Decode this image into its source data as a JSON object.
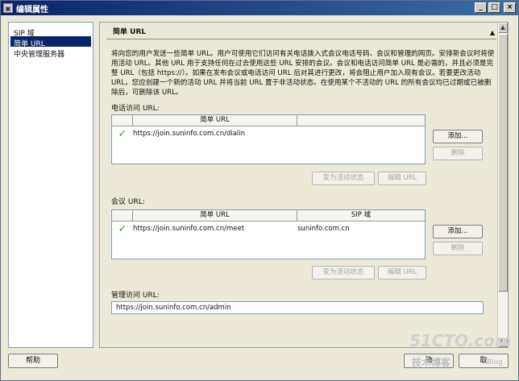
{
  "window": {
    "title": "编辑属性",
    "minimize": "_",
    "maximize": "□",
    "close": "×"
  },
  "nav": {
    "items": [
      {
        "label": "SIP 域"
      },
      {
        "label": "简单 URL"
      },
      {
        "label": "中央管理服务器"
      }
    ],
    "selected_index": 1
  },
  "section": {
    "title": "简单 URL",
    "collapse_glyph": "▲",
    "description": "将向您的用户发送一些简单 URL。用户可使用它们访问有关电话拨入式会议电话号码、会议和管理的网页。安排新会议时将使用活动 URL。其他 URL 用于支持任何在过去使用这些 URL 安排的会议。会议和电话访问简单 URL 是必需的，并且必须是完整 URL（包括 https://）。如果在发布会议或电话访问 URL 后对其进行更改，将会阻止用户加入现有会议。若要更改活动 URL，您应创建一个新的活动 URL 并将当前 URL 置于非活动状态。在使用某个不活动的 URL 的所有会议均已过期或已被删除后，可删除该 URL。"
  },
  "phone_access": {
    "label": "电话访问 URL:",
    "columns": [
      "简单 URL"
    ],
    "rows": [
      {
        "active": true,
        "url": "https://join.suninfo.com.cn/dialin"
      }
    ],
    "add_button": "添加...",
    "remove_button": "删除",
    "make_active_button": "变为活动状态",
    "edit_button": "编辑 URL"
  },
  "meeting": {
    "label": "会议 URL:",
    "columns": [
      "简单 URL",
      "SIP 域"
    ],
    "rows": [
      {
        "active": true,
        "url": "https://join.suninfo.com.cn/meet",
        "sip_domain": "suninfo.com.cn"
      }
    ],
    "add_button": "添加...",
    "remove_button": "删除",
    "make_active_button": "变为活动状态",
    "edit_button": "编辑 URL"
  },
  "admin": {
    "label": "管理访问 URL:",
    "value": "https://join.suninfo.com.cn/admin"
  },
  "footer": {
    "help_button": "帮助",
    "ok_button": "确",
    "cancel_button": "取"
  },
  "watermark": {
    "main": "51CTO.com",
    "sub": "技术博客",
    "blog": "Blog"
  },
  "colors": {
    "title_bar_start": "#0a246a",
    "title_bar_end": "#3a6ea5",
    "selection": "#0a246a",
    "check": "#3aa01a"
  }
}
